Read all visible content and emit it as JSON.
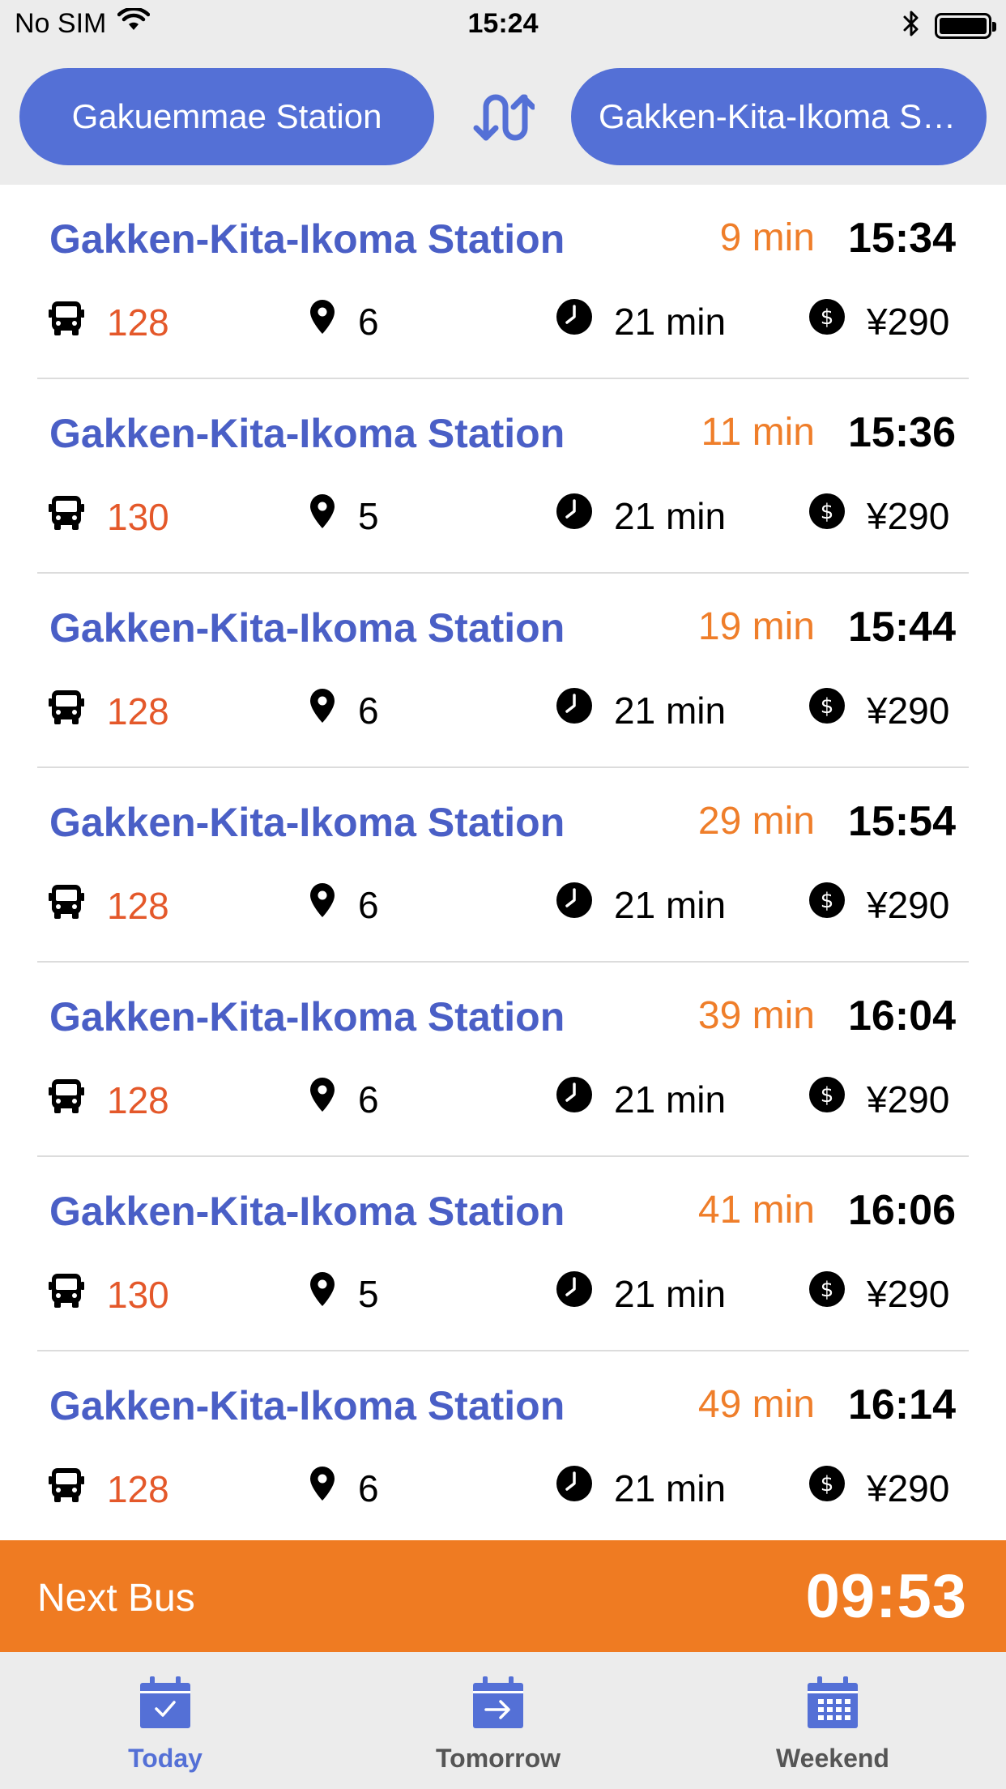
{
  "status_bar": {
    "carrier": "No SIM",
    "time": "15:24",
    "icons": [
      "wifi-icon",
      "bluetooth-icon",
      "battery-icon"
    ]
  },
  "header": {
    "from_station": "Gakuemmae Station",
    "to_station": "Gakken-Kita-Ikoma Station",
    "swap_icon": "swap-icon"
  },
  "departures": [
    {
      "destination": "Gakken-Kita-Ikoma Station",
      "wait": "9 min",
      "departure": "15:34",
      "route": "128",
      "stops": "6",
      "duration": "21 min",
      "fare": "¥290"
    },
    {
      "destination": "Gakken-Kita-Ikoma Station",
      "wait": "11 min",
      "departure": "15:36",
      "route": "130",
      "stops": "5",
      "duration": "21 min",
      "fare": "¥290"
    },
    {
      "destination": "Gakken-Kita-Ikoma Station",
      "wait": "19 min",
      "departure": "15:44",
      "route": "128",
      "stops": "6",
      "duration": "21 min",
      "fare": "¥290"
    },
    {
      "destination": "Gakken-Kita-Ikoma Station",
      "wait": "29 min",
      "departure": "15:54",
      "route": "128",
      "stops": "6",
      "duration": "21 min",
      "fare": "¥290"
    },
    {
      "destination": "Gakken-Kita-Ikoma Station",
      "wait": "39 min",
      "departure": "16:04",
      "route": "128",
      "stops": "6",
      "duration": "21 min",
      "fare": "¥290"
    },
    {
      "destination": "Gakken-Kita-Ikoma Station",
      "wait": "41 min",
      "departure": "16:06",
      "route": "130",
      "stops": "5",
      "duration": "21 min",
      "fare": "¥290"
    },
    {
      "destination": "Gakken-Kita-Ikoma Station",
      "wait": "49 min",
      "departure": "16:14",
      "route": "128",
      "stops": "6",
      "duration": "21 min",
      "fare": "¥290"
    }
  ],
  "next_bus": {
    "label": "Next Bus",
    "countdown": "09:53"
  },
  "tabs": [
    {
      "label": "Today",
      "icon": "calendar-check-icon",
      "active": true
    },
    {
      "label": "Tomorrow",
      "icon": "calendar-arrow-icon",
      "active": false
    },
    {
      "label": "Weekend",
      "icon": "calendar-grid-icon",
      "active": false
    }
  ],
  "colors": {
    "accent": "#5470d6",
    "destination_text": "#4a5fc6",
    "wait_text": "#ef7e2a",
    "route_text": "#e4582a",
    "next_bus_bg": "#ef7b22",
    "bar_bg": "#ececec"
  }
}
